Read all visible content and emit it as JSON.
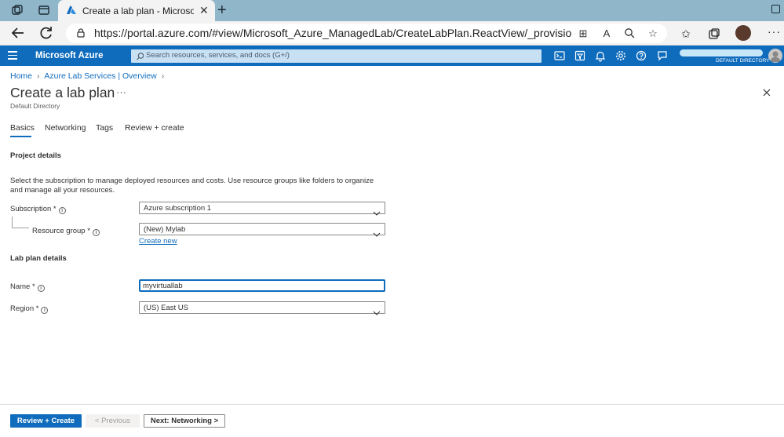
{
  "browser": {
    "tab_title": "Create a lab plan - Microsoft Azu",
    "url": "https://portal.azure.com/#view/Microsoft_Azure_ManagedLab/CreateLabPlan.ReactView/_provisioningContext~/%7B\"i..."
  },
  "azure_header": {
    "brand": "Microsoft Azure",
    "search_placeholder": "Search resources, services, and docs (G+/)",
    "directory": "DEFAULT DIRECTORY"
  },
  "breadcrumb": {
    "items": [
      "Home",
      "Azure Lab Services | Overview"
    ]
  },
  "page": {
    "title": "Create a lab plan",
    "subtitle": "Default Directory"
  },
  "tabs": [
    {
      "label": "Basics",
      "active": true
    },
    {
      "label": "Networking",
      "active": false
    },
    {
      "label": "Tags",
      "active": false
    },
    {
      "label": "Review + create",
      "active": false
    }
  ],
  "project_details": {
    "heading": "Project details",
    "description": "Select the subscription to manage deployed resources and costs. Use resource groups like folders to organize and manage all your resources.",
    "subscription_label": "Subscription *",
    "subscription_value": "Azure subscription 1",
    "resource_group_label": "Resource group *",
    "resource_group_value": "(New) Mylab",
    "create_new": "Create new"
  },
  "lab_plan_details": {
    "heading": "Lab plan details",
    "name_label": "Name *",
    "name_value": "myvirtuallab",
    "region_label": "Region *",
    "region_value": "(US) East US"
  },
  "footer": {
    "review_create": "Review + Create",
    "previous": "< Previous",
    "next": "Next: Networking >"
  },
  "colors": {
    "azure_blue": "#0f6cbd",
    "tabbar": "#8fb6c9",
    "search_bg": "#c7e0f4"
  }
}
